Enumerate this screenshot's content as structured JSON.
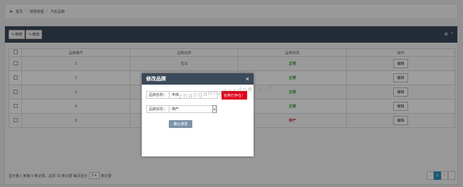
{
  "breadcrumb": {
    "items": [
      "首页",
      "常规管理",
      "汽车品牌"
    ]
  },
  "toolbar": {
    "add_label": "新增",
    "edit_label": "修改"
  },
  "table": {
    "headers": [
      "",
      "品牌编号",
      "品牌名称",
      "品牌状态",
      "操作"
    ],
    "rows": [
      {
        "id": "1",
        "name": "宝马",
        "status": "正常",
        "status_type": "on",
        "action": "编辑"
      },
      {
        "id": "2",
        "name": "",
        "status": "正常",
        "status_type": "on",
        "action": "编辑"
      },
      {
        "id": "3",
        "name": "",
        "status": "正常",
        "status_type": "on",
        "action": "编辑"
      },
      {
        "id": "4",
        "name": "",
        "status": "正常",
        "status_type": "on",
        "action": "编辑"
      },
      {
        "id": "5",
        "name": "",
        "status": "停产",
        "status_type": "off",
        "action": "编辑"
      }
    ]
  },
  "footer": {
    "summary": "显示第 1 到第 5 条记录，总共 10 条记录 每页显示",
    "page_size": "5",
    "suffix": "条记录",
    "pages": [
      "‹",
      "1",
      "2",
      "›"
    ]
  },
  "modal": {
    "title": "修改品牌",
    "close": "×",
    "name_label": "品牌名称：",
    "name_value": "丰田",
    "error": "名称已存在！",
    "status_label": "品牌状态：",
    "status_value": "停产",
    "submit": "确认修改"
  },
  "watermark": "zhanganna@csdnmfs.n",
  "colors": {
    "header": "#3b4a5a",
    "active_page": "#2f93c1",
    "error": "#e0001a",
    "status_on": "#2a9a2a",
    "status_off": "#d33333"
  }
}
